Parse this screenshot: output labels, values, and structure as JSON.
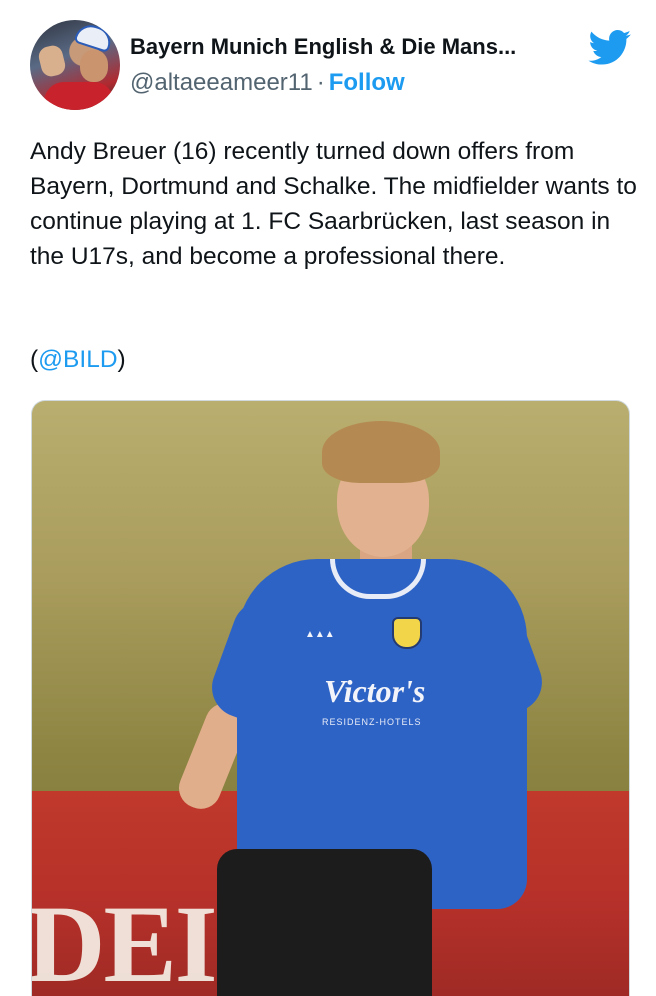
{
  "tweet": {
    "author_name": "Bayern Munich English & Die Mans...",
    "handle": "@altaeeameer11",
    "separator": "·",
    "follow_label": "Follow",
    "text": "Andy Breuer (16) recently turned down offers from Bayern, Dortmund and Schalke. The midfielder wants to continue playing at 1. FC Saarbrücken, last season in the U17s, and become a professional there.",
    "source_open": "(",
    "source_mention": "@BILD",
    "source_close": ")"
  },
  "media": {
    "sponsor": "Victor's",
    "sponsor_sub": "RESIDENZ-HOTELS",
    "wall_text": "DEI"
  },
  "colors": {
    "accent": "#1d9bf0",
    "text": "#0f1419",
    "muted": "#536471"
  },
  "icons": {
    "brand": "twitter-bird-icon"
  }
}
